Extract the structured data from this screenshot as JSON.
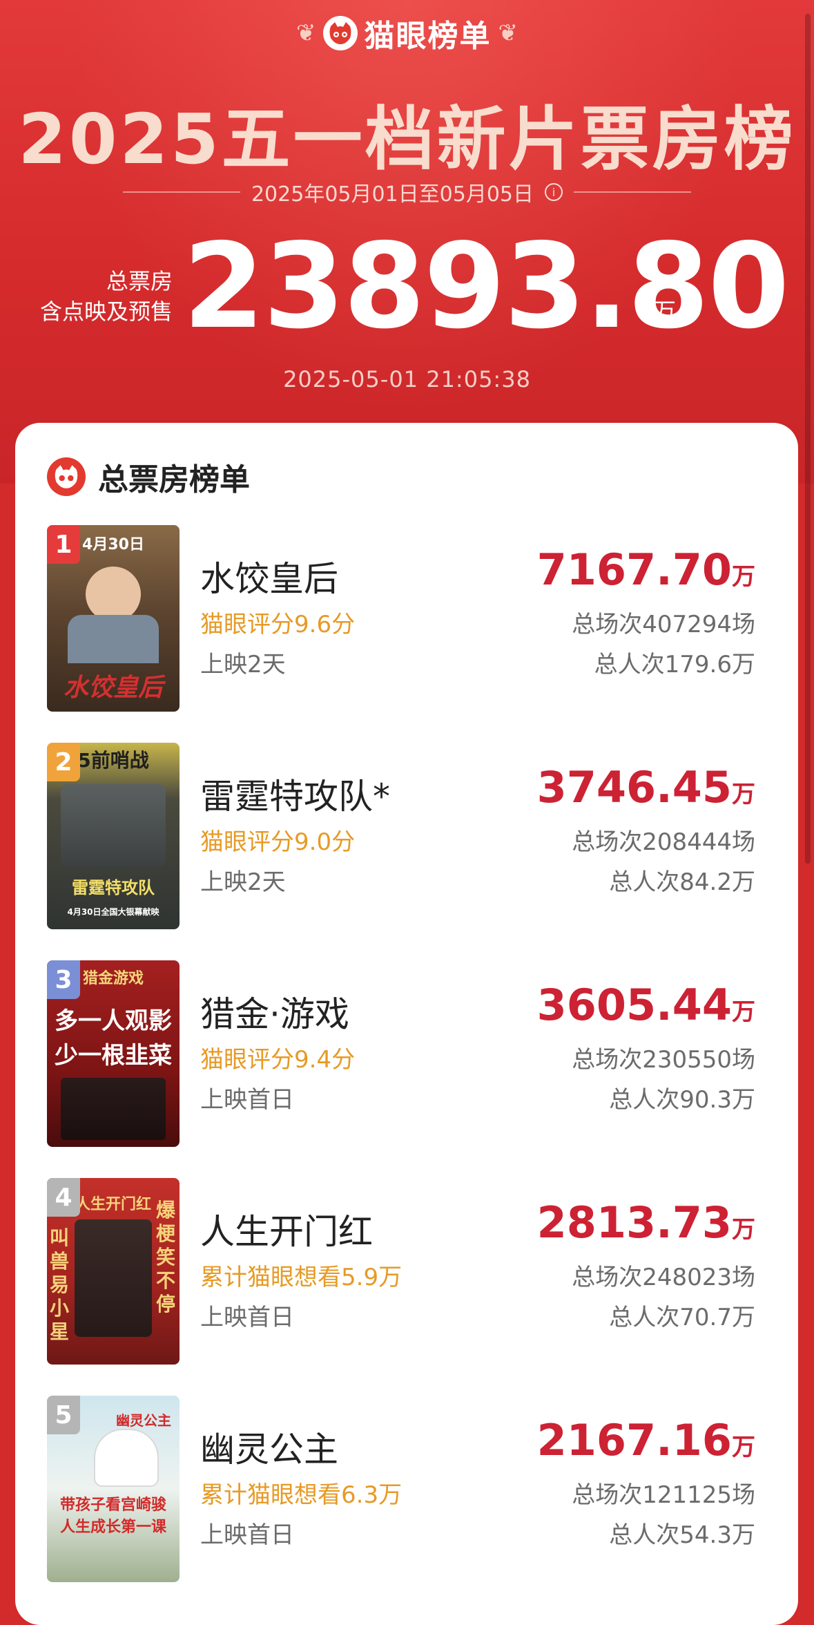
{
  "brand": {
    "name": "猫眼榜单"
  },
  "header": {
    "title": "2025五一档新片票房榜",
    "date_range": "2025年05月01日至05月05日",
    "total_label_1": "总票房",
    "total_label_2": "含点映及预售",
    "total_value": "23893.80",
    "total_unit": "万",
    "update_time": "2025-05-01  21:05:38"
  },
  "list": {
    "title": "总票房榜单",
    "movies": [
      {
        "rank": "1",
        "name": "水饺皇后",
        "score": "猫眼评分9.6分",
        "days": "上映2天",
        "box_office": "7167.70",
        "unit": "万",
        "shows": "总场次407294场",
        "audience": "总人次179.6万",
        "badge_color": "#e63b3b"
      },
      {
        "rank": "2",
        "name": "雷霆特攻队*",
        "score": "猫眼评分9.0分",
        "days": "上映2天",
        "box_office": "3746.45",
        "unit": "万",
        "shows": "总场次208444场",
        "audience": "总人次84.2万",
        "badge_color": "#f0a33a"
      },
      {
        "rank": "3",
        "name": "猎金·游戏",
        "score": "猫眼评分9.4分",
        "days": "上映首日",
        "box_office": "3605.44",
        "unit": "万",
        "shows": "总场次230550场",
        "audience": "总人次90.3万",
        "badge_color": "#7a8fd6"
      },
      {
        "rank": "4",
        "name": "人生开门红",
        "score": "累计猫眼想看5.9万",
        "days": "上映首日",
        "box_office": "2813.73",
        "unit": "万",
        "shows": "总场次248023场",
        "audience": "总人次70.7万",
        "badge_color": "#b5b5b5"
      },
      {
        "rank": "5",
        "name": "幽灵公主",
        "score": "累计猫眼想看6.3万",
        "days": "上映首日",
        "box_office": "2167.16",
        "unit": "万",
        "shows": "总场次121125场",
        "audience": "总人次54.3万",
        "badge_color": "#b5b5b5"
      }
    ]
  },
  "posters": [
    {
      "line1": "4月30日",
      "line2": "水饺皇后"
    },
    {
      "line1": "5前哨战",
      "line2": "雷霆特攻队",
      "line3": "4月30日全国大银幕献映"
    },
    {
      "line1": "猎金游戏",
      "line2": "多一人观影",
      "line3": "少一根韭菜"
    },
    {
      "line1": "人生开门红",
      "line2": "爆梗笑不停",
      "line3": "叫兽易小星"
    },
    {
      "line1": "幽灵公主",
      "line2": "带孩子看宫崎骏",
      "line3": "人生成长第一课"
    }
  ]
}
